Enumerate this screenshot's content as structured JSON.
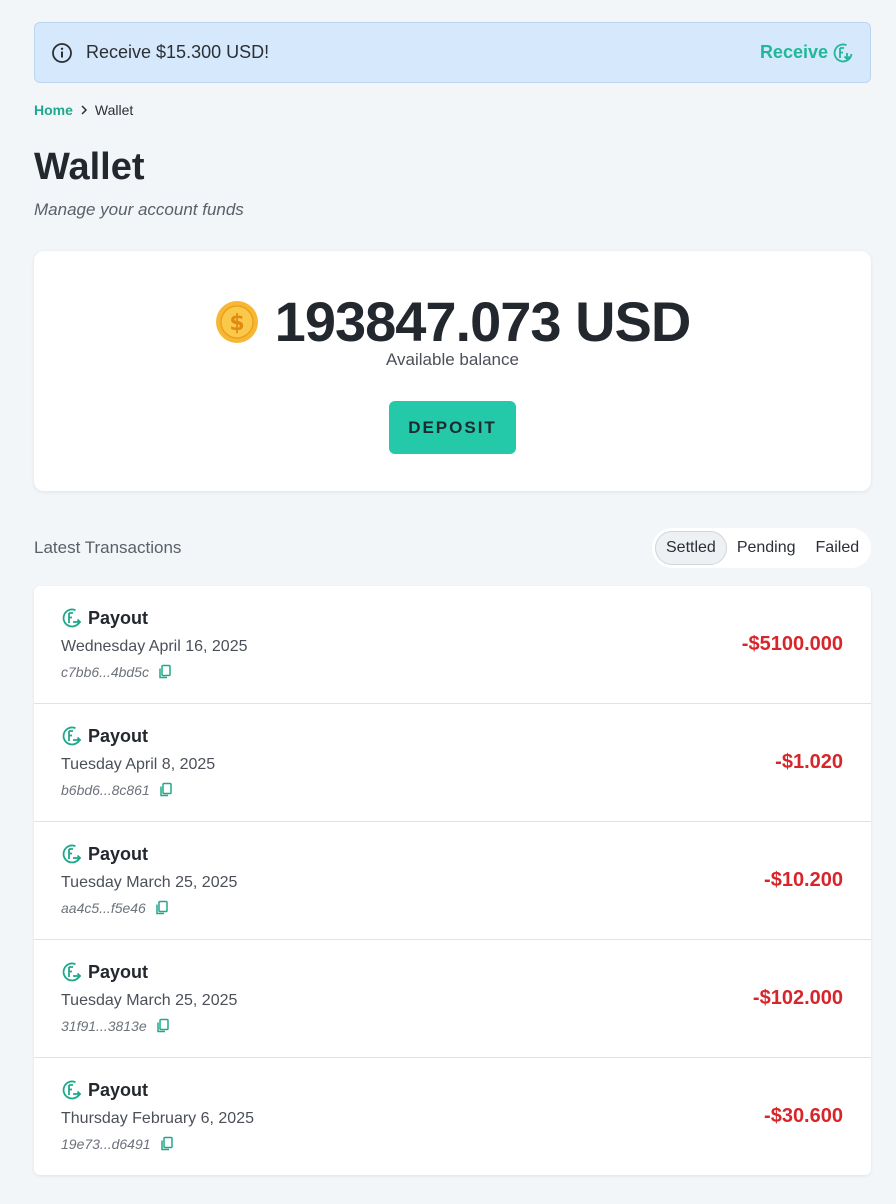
{
  "banner": {
    "message": "Receive $15.300 USD!",
    "action_label": "Receive",
    "info_icon": "info-circle-icon",
    "action_icon": "receive-icon"
  },
  "breadcrumb": {
    "home": "Home",
    "current": "Wallet"
  },
  "page": {
    "title": "Wallet",
    "subtitle": "Manage your account funds"
  },
  "balance": {
    "amount": "193847.073 USD",
    "label": "Available balance",
    "deposit_label": "DEPOSIT",
    "coin_icon": "dollar-coin-icon"
  },
  "transactions": {
    "heading": "Latest Transactions",
    "filters": [
      "Settled",
      "Pending",
      "Failed"
    ],
    "active_filter": "Settled",
    "items": [
      {
        "type": "Payout",
        "date": "Wednesday April 16, 2025",
        "hash": "c7bb6...4bd5c",
        "amount": "-$5100.000"
      },
      {
        "type": "Payout",
        "date": "Tuesday April 8, 2025",
        "hash": "b6bd6...8c861",
        "amount": "-$1.020"
      },
      {
        "type": "Payout",
        "date": "Tuesday March 25, 2025",
        "hash": "aa4c5...f5e46",
        "amount": "-$10.200"
      },
      {
        "type": "Payout",
        "date": "Tuesday March 25, 2025",
        "hash": "31f91...3813e",
        "amount": "-$102.000"
      },
      {
        "type": "Payout",
        "date": "Thursday February 6, 2025",
        "hash": "19e73...d6491",
        "amount": "-$30.600"
      }
    ]
  },
  "colors": {
    "accent": "#20b79a",
    "button": "#23c9a9",
    "negative": "#d7262b",
    "banner_bg": "#d6e8fb"
  }
}
